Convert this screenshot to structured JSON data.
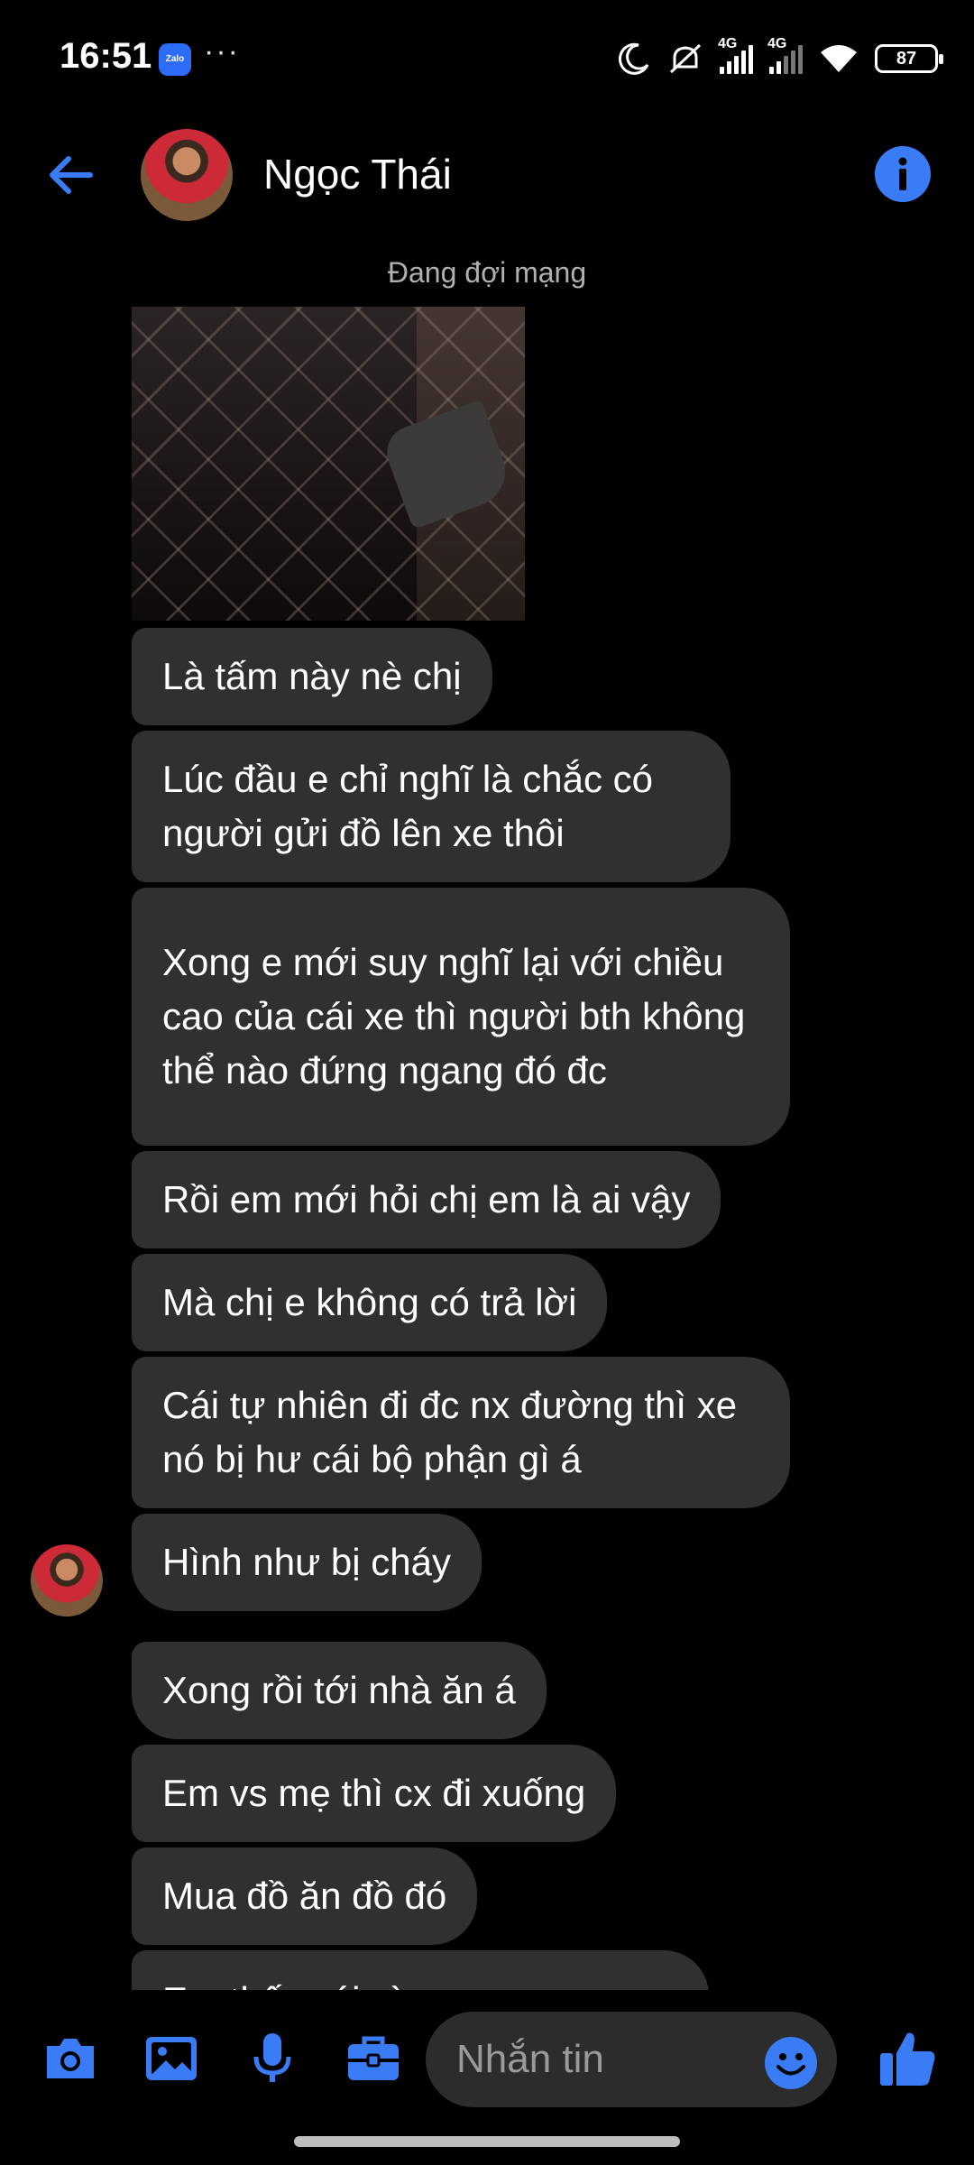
{
  "status_bar": {
    "time": "16:51",
    "zalo_label": "Zalo",
    "more": "···",
    "net1": "4G",
    "net2": "4G",
    "battery": "87"
  },
  "header": {
    "contact_name": "Ngọc Thái"
  },
  "network_status": "Đang đợi mạng",
  "messages": [
    "Là tấm này nè chị",
    "Lúc đầu e chỉ nghĩ là chắc có người gửi đồ lên xe thôi",
    "Xong e mới suy nghĩ lại với chiều cao của cái xe thì người bth không thể nào đứng ngang đó đc",
    "Rồi em mới hỏi chị em là ai vậy",
    "Mà chị e không có trả lời",
    "Cái tự nhiên đi đc nx đường thì xe nó bị hư cái bộ phận gì á",
    "Hình như bị cháy",
    "Xong rồi tới nhà ăn á",
    "Em vs mẹ thì cx đi xuống",
    "Mua đồ ăn đồ đó",
    "Em thấy cái gì ..."
  ],
  "composer": {
    "placeholder": "Nhắn tin"
  },
  "colors": {
    "accent": "#3a7cf5",
    "bubble": "#303030",
    "background": "#000000"
  },
  "icons": [
    "back-arrow-icon",
    "info-icon",
    "camera-icon",
    "image-icon",
    "microphone-icon",
    "briefcase-icon",
    "emoji-icon",
    "thumbs-up-icon",
    "moon-icon",
    "mute-icon",
    "wifi-icon"
  ]
}
